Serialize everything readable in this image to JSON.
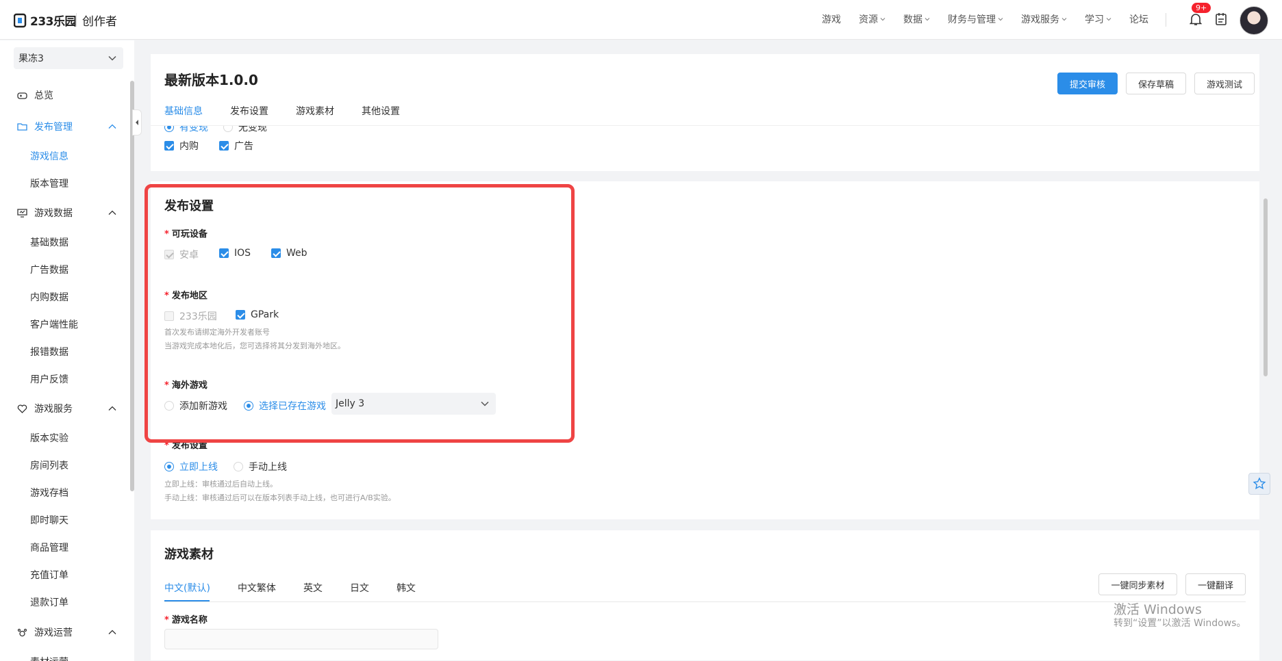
{
  "header": {
    "logo_text": "233乐园",
    "brand": "创作者",
    "nav": [
      "游戏",
      "资源",
      "数据",
      "财务与管理",
      "游戏服务",
      "学习",
      "论坛"
    ],
    "notification_badge": "9+"
  },
  "sidebar": {
    "project": "果冻3",
    "groups": [
      {
        "label": "总览"
      },
      {
        "label": "发布管理",
        "items": [
          "游戏信息",
          "版本管理"
        ]
      },
      {
        "label": "游戏数据",
        "items": [
          "基础数据",
          "广告数据",
          "内购数据",
          "客户端性能",
          "报错数据",
          "用户反馈"
        ]
      },
      {
        "label": "游戏服务",
        "items": [
          "版本实验",
          "房间列表",
          "游戏存档",
          "即时聊天",
          "商品管理",
          "充值订单",
          "退款订单"
        ]
      },
      {
        "label": "游戏运营",
        "items": [
          "素材运营"
        ]
      }
    ]
  },
  "version_card": {
    "title": "最新版本1.0.0",
    "buttons": {
      "submit": "提交审核",
      "save": "保存草稿",
      "test": "游戏测试"
    },
    "tabs": [
      "基础信息",
      "发布设置",
      "游戏素材",
      "其他设置"
    ],
    "monetize": [
      "有变现",
      "无变现"
    ],
    "monetize_types": [
      "内购",
      "广告"
    ]
  },
  "publish": {
    "title": "发布设置",
    "devices_label": "可玩设备",
    "devices": [
      "安卓",
      "IOS",
      "Web"
    ],
    "region_label": "发布地区",
    "regions": [
      "233乐园",
      "GPark"
    ],
    "region_hint_1": "首次发布请绑定海外开发者账号",
    "region_hint_2": "当游戏完成本地化后，您可选择将其分发到海外地区。",
    "overseas_label": "海外游戏",
    "overseas_options": [
      "添加新游戏",
      "选择已存在游戏"
    ],
    "overseas_selected_game": "Jelly 3",
    "release_label": "发布设置",
    "release_options": [
      "立即上线",
      "手动上线"
    ],
    "release_hint_1": "立即上线：审核通过后自动上线。",
    "release_hint_2": "手动上线：审核通过后可以在版本列表手动上线，也可进行A/B实验。"
  },
  "assets": {
    "title": "游戏素材",
    "lang_tabs": [
      "中文(默认)",
      "中文繁体",
      "英文",
      "日文",
      "韩文"
    ],
    "sync_button": "一键同步素材",
    "translate_button": "一键翻译",
    "game_name_label": "游戏名称"
  },
  "watermark": {
    "line1": "激活 Windows",
    "line2": "转到“设置”以激活 Windows。"
  },
  "colors": {
    "accent": "#2b8de8",
    "highlight_box": "#ef4444",
    "required": "#f5222d"
  }
}
